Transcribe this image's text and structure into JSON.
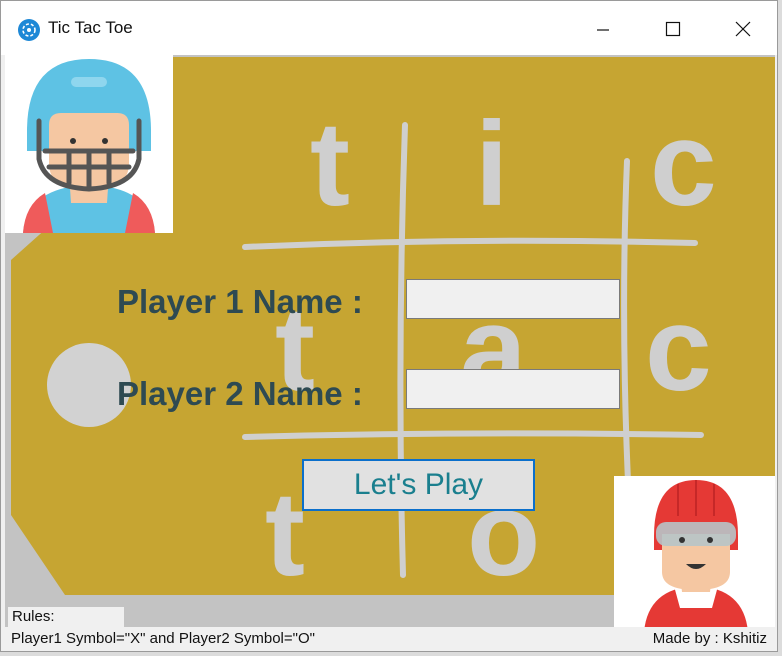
{
  "window": {
    "title": "Tic Tac Toe",
    "icon": "app-icon",
    "controls": [
      "minimize-icon",
      "maximize-icon",
      "close-icon"
    ]
  },
  "background": {
    "letters": [
      "t",
      "i",
      "c",
      "t",
      "a",
      "c",
      "t",
      "o"
    ],
    "colors": {
      "board": "#c6a532",
      "chalk": "#cfcfcf"
    }
  },
  "form": {
    "player1_label": "Player 1 Name :",
    "player1_value": "",
    "player2_label": "Player 2 Name :",
    "player2_value": "",
    "play_button": "Let's Play"
  },
  "footer": {
    "rules_label": "Rules:",
    "rules_text": "Player1 Symbol=\"X\" and Player2 Symbol=\"O\"",
    "credit": "Made by : Kshitiz"
  },
  "avatars": {
    "player1": "football-player-icon",
    "player2": "hockey-player-icon"
  },
  "colors": {
    "label_text": "#2e4a52",
    "button_border": "#0b6fcb",
    "button_text": "#1a7f8e"
  }
}
